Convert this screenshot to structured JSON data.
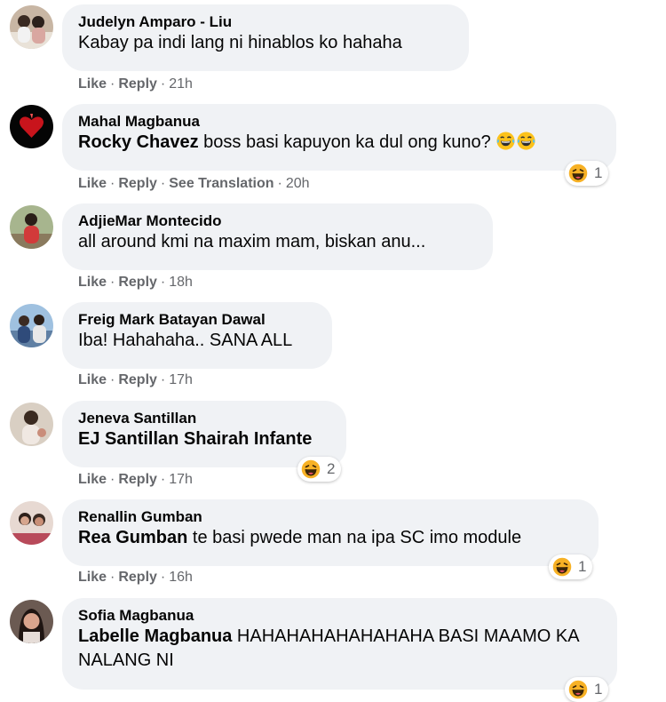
{
  "comments": [
    {
      "author": "Judelyn Amparo - Liu",
      "tag": "",
      "text": "Kabay pa indi lang ni hinablos ko hahaha",
      "like": "Like",
      "reply": "Reply",
      "translate": "",
      "time": "21h",
      "reaction_count": ""
    },
    {
      "author": "Mahal Magbanua",
      "tag": "Rocky Chavez",
      "text": " boss basi kapuyon ka dul ong kuno? ",
      "like": "Like",
      "reply": "Reply",
      "translate": "See Translation",
      "time": "20h",
      "reaction_count": "1"
    },
    {
      "author": "AdjieMar Montecido",
      "tag": "",
      "text": "all around kmi na maxim mam, biskan anu...",
      "like": "Like",
      "reply": "Reply",
      "translate": "",
      "time": "18h",
      "reaction_count": ""
    },
    {
      "author": "Freig Mark Batayan Dawal",
      "tag": "",
      "text": "Iba! Hahahaha.. SANA ALL",
      "like": "Like",
      "reply": "Reply",
      "translate": "",
      "time": "17h",
      "reaction_count": ""
    },
    {
      "author": "Jeneva Santillan",
      "tag": "EJ Santillan Shairah Infante",
      "text": "",
      "like": "Like",
      "reply": "Reply",
      "translate": "",
      "time": "17h",
      "reaction_count": "2"
    },
    {
      "author": "Renallin Gumban",
      "tag": "Rea Gumban",
      "text": " te basi pwede man na ipa SC imo module",
      "like": "Like",
      "reply": "Reply",
      "translate": "",
      "time": "16h",
      "reaction_count": "1"
    },
    {
      "author": "Sofia Magbanua",
      "tag": "Labelle Magbanua",
      "text": " HAHAHAHAHAHAHAHA BASI MAAMO KA NALANG NI",
      "like": "",
      "reply": "",
      "translate": "",
      "time": "",
      "reaction_count": "1"
    }
  ],
  "colors": {
    "bubble": "#f0f2f5",
    "meta": "#65676b",
    "text": "#050505",
    "haha": "#f7b125"
  },
  "icons": {
    "reaction": "haha-icon",
    "inline_emoji": "tears-of-joy-icon"
  }
}
